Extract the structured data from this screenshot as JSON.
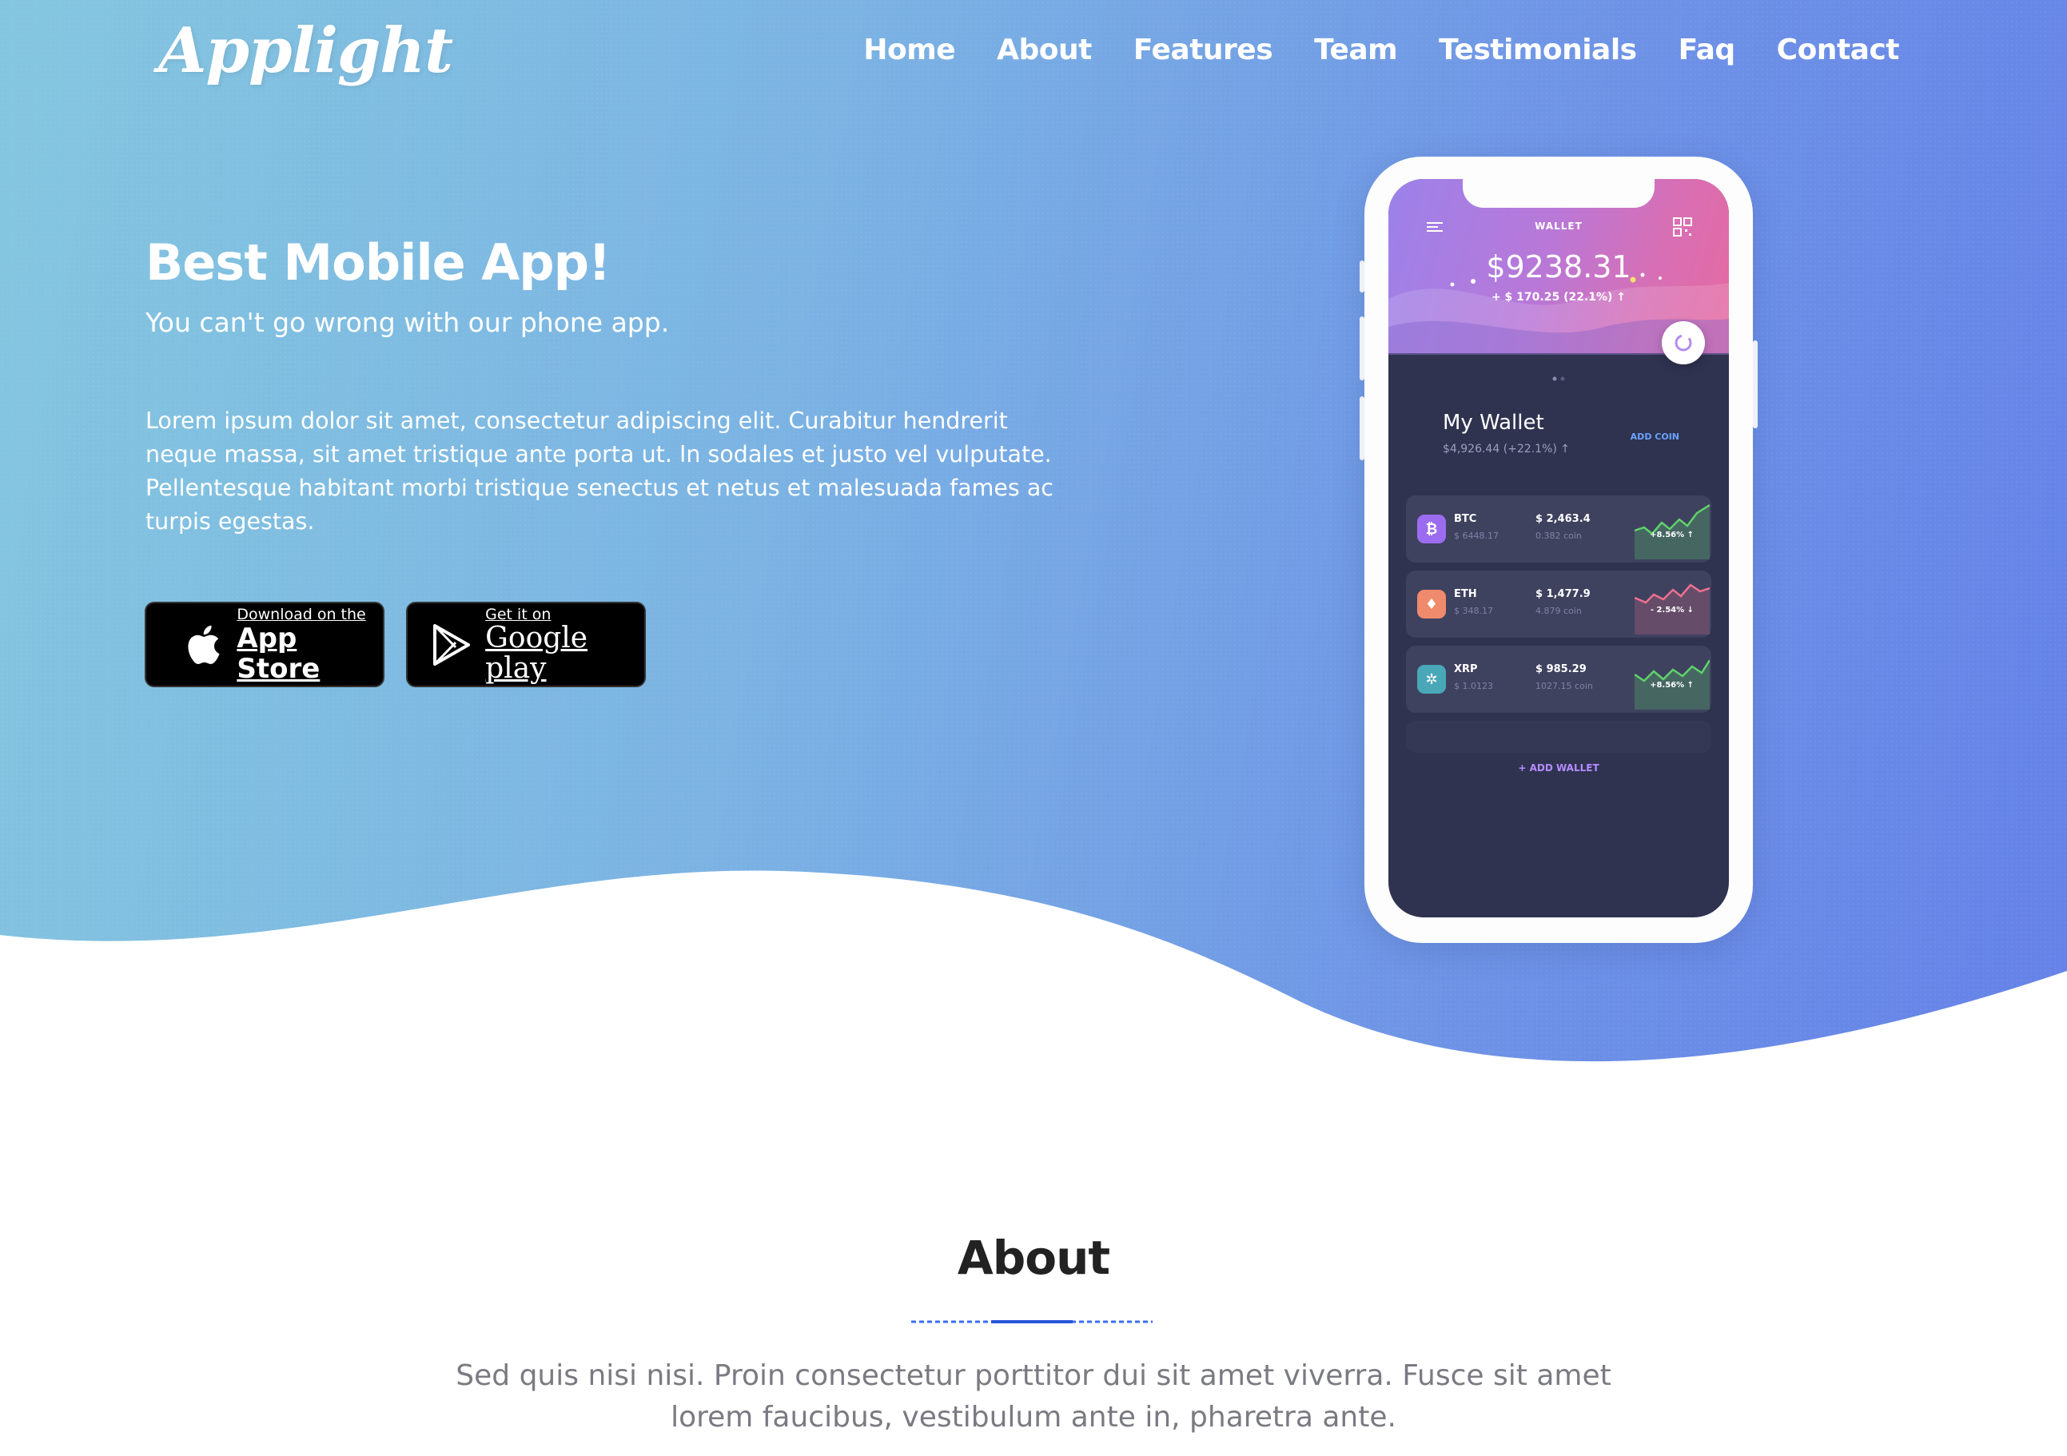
{
  "brand": {
    "logo": "Applight"
  },
  "nav": {
    "items": [
      {
        "label": "Home"
      },
      {
        "label": "About"
      },
      {
        "label": "Features"
      },
      {
        "label": "Team"
      },
      {
        "label": "Testimonials"
      },
      {
        "label": "Faq"
      },
      {
        "label": "Contact"
      }
    ]
  },
  "hero": {
    "title": "Best Mobile App!",
    "subtitle": "You can't go wrong with our phone app.",
    "body": "Lorem ipsum dolor sit amet, consectetur adipiscing elit. Curabitur hendrerit neque massa, sit amet tristique ante porta ut. In sodales et justo vel vulputate. Pellentesque habitant morbi tristique senectus et netus et malesuada fames ac turpis egestas.",
    "app_store": {
      "small": "Download on the",
      "big": "App Store"
    },
    "google_play": {
      "small": "Get it on",
      "big": "Google play"
    }
  },
  "phone": {
    "wallet_label": "WALLET",
    "balance": "$9238.31",
    "balance_change": "+ $ 170.25 (22.1%) ↑",
    "my_wallet": "My Wallet",
    "my_wallet_sub": "$4,926.44 (+22.1%) ↑",
    "add_coin": "ADD COIN",
    "coins": [
      {
        "symbol": "BTC",
        "sub": "$ 6448.17",
        "value": "$ 2,463.4",
        "amount": "0.382 coin",
        "pct": "+8.56% ↑",
        "badge_color": "#9b6cf0",
        "glyph": "₿",
        "trend_color": "#5fd36a"
      },
      {
        "symbol": "ETH",
        "sub": "$ 348.17",
        "value": "$ 1,477.9",
        "amount": "4.879 coin",
        "pct": "- 2.54% ↓",
        "badge_color": "#f08a6c",
        "glyph": "♦",
        "trend_color": "#f0708e"
      },
      {
        "symbol": "XRP",
        "sub": "$ 1.0123",
        "value": "$ 985.29",
        "amount": "1027.15 coin",
        "pct": "+8.56% ↑",
        "badge_color": "#4aa7b8",
        "glyph": "✲",
        "trend_color": "#5fd36a"
      }
    ],
    "add_wallet": "+ ADD WALLET"
  },
  "about": {
    "title": "About",
    "text": "Sed quis nisi nisi. Proin consectetur porttitor dui sit amet viverra. Fusce sit amet lorem faucibus, vestibulum ante in, pharetra ante."
  },
  "colors": {
    "hero_gradient_start": "#84c6df",
    "hero_gradient_end": "#6582e8",
    "divider": "#3a6ff0"
  }
}
